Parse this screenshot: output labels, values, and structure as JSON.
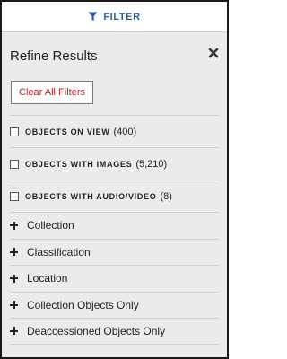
{
  "filter_bar": {
    "label": "FILTER",
    "accent_color": "#2a5da8",
    "icon": "funnel-icon"
  },
  "panel": {
    "title": "Refine Results",
    "close_icon": "close-icon"
  },
  "clear_button": {
    "label": "Clear All Filters",
    "color": "#b5242a"
  },
  "checkbox_filters": [
    {
      "label": "OBJECTS ON VIEW",
      "count": "(400)",
      "checked": false
    },
    {
      "label": "OBJECTS WITH IMAGES",
      "count": "(5,210)",
      "checked": false
    },
    {
      "label": "OBJECTS WITH AUDIO/VIDEO",
      "count": "(8)",
      "checked": false
    }
  ],
  "facets": [
    {
      "label": "Collection",
      "icon": "plus-icon"
    },
    {
      "label": "Classification",
      "icon": "plus-icon"
    },
    {
      "label": "Location",
      "icon": "plus-icon"
    },
    {
      "label": "Collection Objects Only",
      "icon": "plus-icon"
    },
    {
      "label": "Deaccessioned Objects Only",
      "icon": "plus-icon"
    }
  ]
}
